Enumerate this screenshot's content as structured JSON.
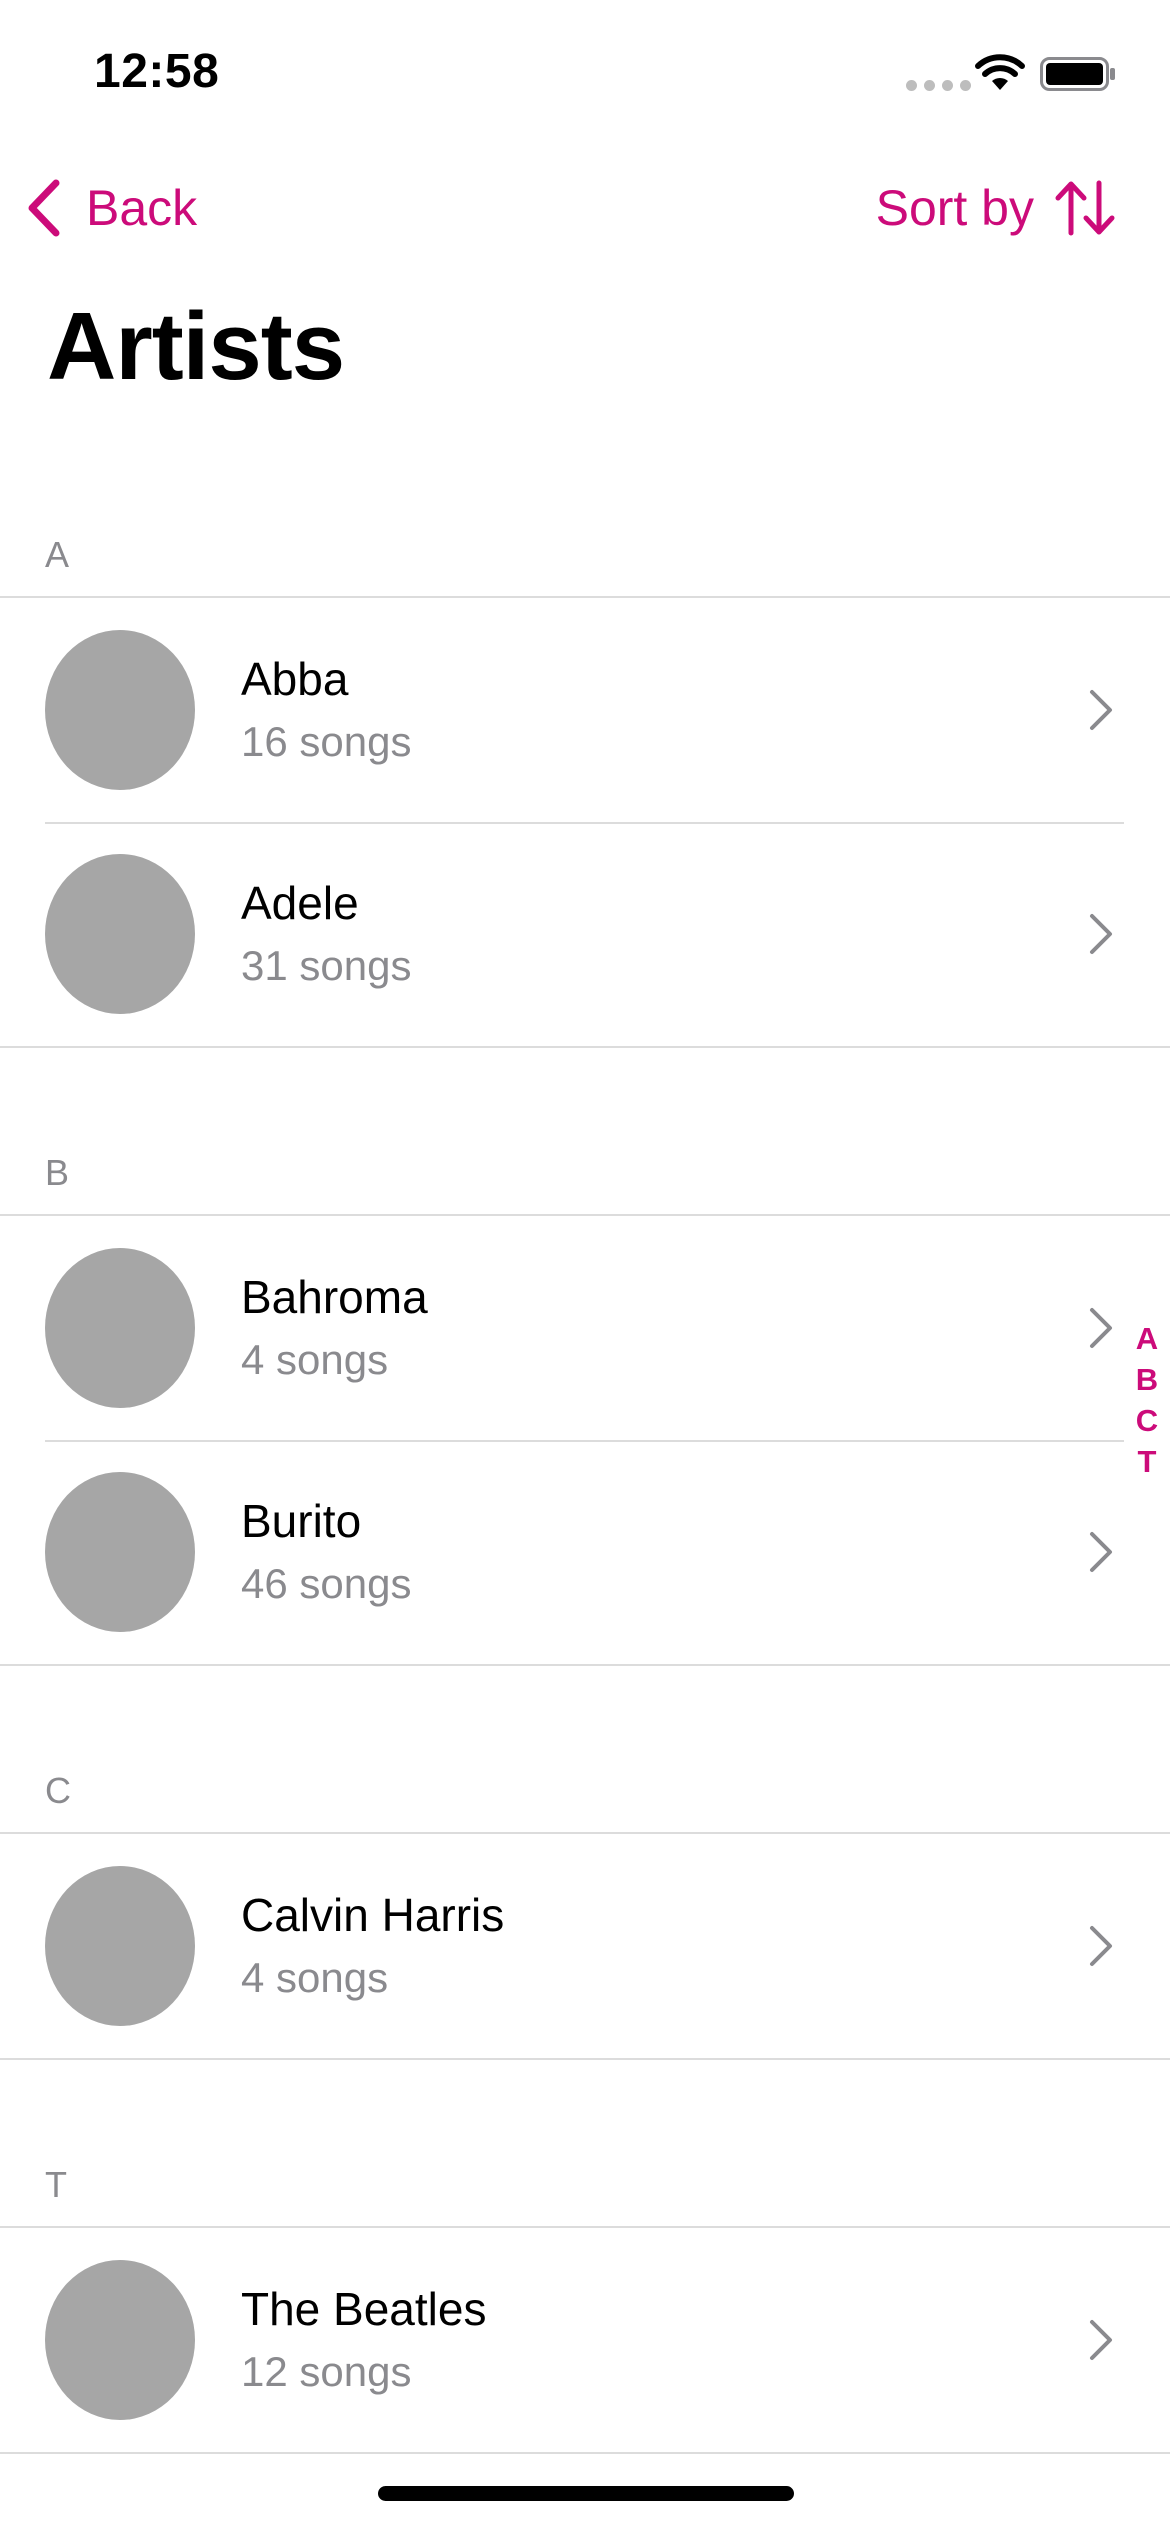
{
  "status_bar": {
    "time": "12:58",
    "signal_icon": "cellular-signal-icon",
    "wifi_icon": "wifi-icon",
    "battery_icon": "battery-icon"
  },
  "nav": {
    "back_label": "Back",
    "back_icon": "chevron-left-icon",
    "sort_label": "Sort by",
    "sort_icon": "sort-arrows-icon"
  },
  "page_title": "Artists",
  "accent_color": "#cc0b7a",
  "sections": [
    {
      "letter": "A",
      "artists": [
        {
          "name": "Abba",
          "count": "16 songs"
        },
        {
          "name": "Adele",
          "count": "31 songs"
        }
      ]
    },
    {
      "letter": "B",
      "artists": [
        {
          "name": "Bahroma",
          "count": "4 songs"
        },
        {
          "name": "Burito",
          "count": "46 songs"
        }
      ]
    },
    {
      "letter": "C",
      "artists": [
        {
          "name": "Calvin Harris",
          "count": "4 songs"
        }
      ]
    },
    {
      "letter": "T",
      "artists": [
        {
          "name": "The Beatles",
          "count": "12 songs"
        }
      ]
    }
  ],
  "index_letters": [
    "A",
    "B",
    "C",
    "T"
  ]
}
